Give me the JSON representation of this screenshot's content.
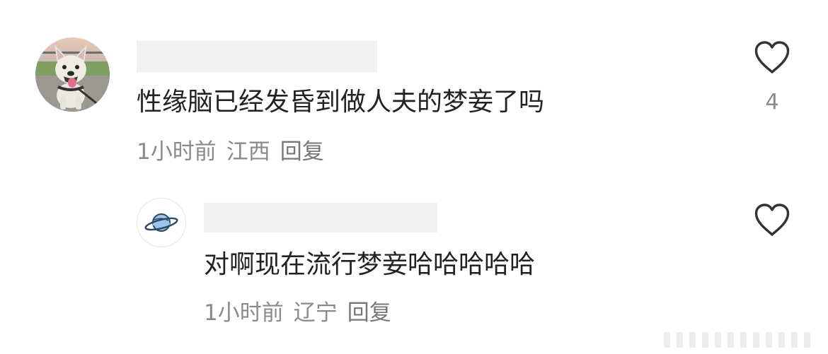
{
  "comments": [
    {
      "avatar_icon": "french-bulldog-avatar",
      "text": "性缘脑已经发昏到做人夫的梦妾了吗",
      "time": "1小时前",
      "location": "江西",
      "reply_label": "回复",
      "like_icon": "heart-outline-icon",
      "like_count": "4"
    },
    {
      "avatar_icon": "planet-avatar",
      "text": "对啊现在流行梦妾哈哈哈哈哈",
      "time": "1小时前",
      "location": "辽宁",
      "reply_label": "回复",
      "like_icon": "heart-outline-icon",
      "like_count": ""
    }
  ],
  "colors": {
    "text_primary": "#222222",
    "text_secondary": "#8a8a8a",
    "redaction": "#f1f1f1",
    "icon_stroke": "#333333"
  }
}
